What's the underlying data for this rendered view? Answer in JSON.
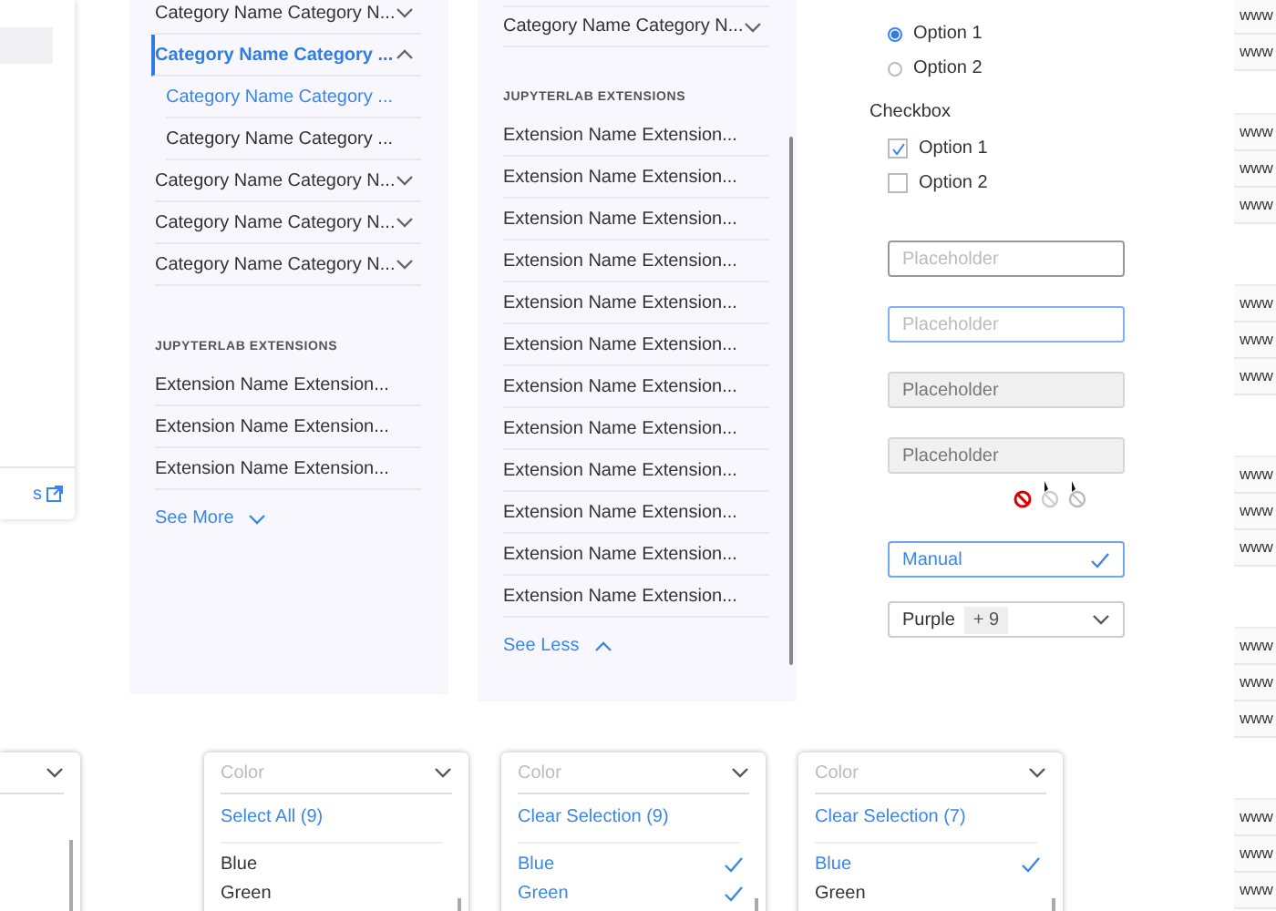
{
  "side_card": {
    "link": "s"
  },
  "panels": [
    {
      "categories": [
        {
          "label": "Category Name Category N...",
          "expanded": false,
          "selected": false
        },
        {
          "label": "Category Name Category ...",
          "expanded": true,
          "selected": true,
          "children": [
            {
              "label": "Category Name Category ...",
              "selected": true
            },
            {
              "label": "Category Name Category ...",
              "selected": false
            }
          ]
        },
        {
          "label": "Category Name Category N...",
          "expanded": false,
          "selected": false
        },
        {
          "label": "Category Name Category N...",
          "expanded": false,
          "selected": false
        },
        {
          "label": "Category Name Category N...",
          "expanded": false,
          "selected": false
        }
      ],
      "section_title": "JUPYTERLAB EXTENSIONS",
      "extensions": [
        "Extension Name Extension...",
        "Extension Name Extension...",
        "Extension Name Extension..."
      ],
      "toggle": {
        "label": "See More",
        "expanded": false
      }
    },
    {
      "categories": [
        {
          "label": "Category Name Category N...",
          "expanded": false,
          "selected": false
        }
      ],
      "section_title": "JUPYTERLAB EXTENSIONS",
      "extensions": [
        "Extension Name Extension...",
        "Extension Name Extension...",
        "Extension Name Extension...",
        "Extension Name Extension...",
        "Extension Name Extension...",
        "Extension Name Extension...",
        "Extension Name Extension...",
        "Extension Name Extension...",
        "Extension Name Extension...",
        "Extension Name Extension...",
        "Extension Name Extension...",
        "Extension Name Extension..."
      ],
      "toggle": {
        "label": "See Less",
        "expanded": true
      }
    }
  ],
  "radio_options": [
    {
      "label": "Option 1",
      "selected": true
    },
    {
      "label": "Option 2",
      "selected": false
    }
  ],
  "checkbox": {
    "title": "Checkbox",
    "options": [
      {
        "label": "Option 1",
        "checked": true
      },
      {
        "label": "Option 2",
        "checked": false
      }
    ]
  },
  "inputs": [
    {
      "placeholder": "Placeholder",
      "focused": false,
      "disabled": false
    },
    {
      "placeholder": "Placeholder",
      "focused": true,
      "disabled": false
    },
    {
      "placeholder": "Placeholder",
      "focused": false,
      "disabled": true
    },
    {
      "placeholder": "Placeholder",
      "focused": false,
      "disabled": true
    }
  ],
  "selects": [
    {
      "kind": "confirmed",
      "value": "Manual"
    },
    {
      "kind": "multi",
      "value": "Purple",
      "count": "+ 9"
    }
  ],
  "dropdowns": [
    {
      "kind": "partial"
    },
    {
      "kind": "full",
      "placeholder": "Color",
      "action": "Select All (9)",
      "options": [
        {
          "label": "Blue",
          "selected": false
        },
        {
          "label": "Green",
          "selected": false
        }
      ]
    },
    {
      "kind": "full",
      "placeholder": "Color",
      "action": "Clear Selection (9)",
      "options": [
        {
          "label": "Blue",
          "selected": true
        },
        {
          "label": "Green",
          "selected": true
        }
      ]
    },
    {
      "kind": "full",
      "placeholder": "Color",
      "action": "Clear Selection (7)",
      "options": [
        {
          "label": "Blue",
          "selected": true
        },
        {
          "label": "Green",
          "selected": false
        }
      ]
    }
  ],
  "url_groups": [
    [
      "www",
      "www"
    ],
    [
      "www",
      "www",
      "www"
    ],
    [
      "www",
      "www",
      "www"
    ],
    [
      "www",
      "www",
      "www"
    ],
    [
      "www",
      "www",
      "www"
    ],
    [
      "www",
      "www",
      "www"
    ]
  ]
}
